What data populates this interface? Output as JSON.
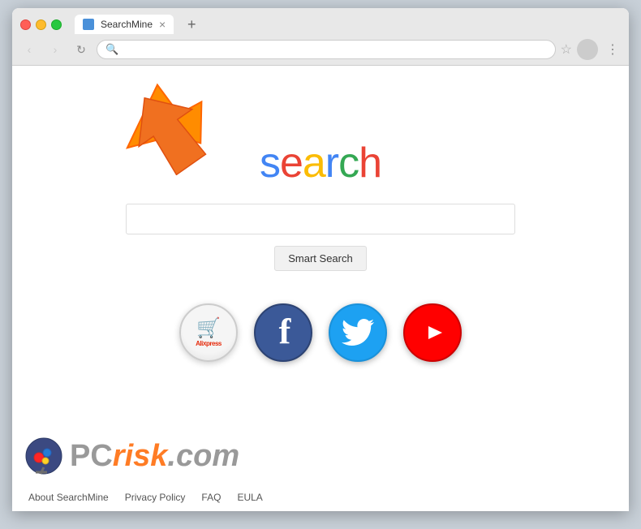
{
  "browser": {
    "tab_label": "SearchMine",
    "tab_close": "×",
    "tab_new": "+",
    "address_value": "",
    "address_placeholder": ""
  },
  "nav": {
    "back": "‹",
    "forward": "›",
    "refresh": "↻"
  },
  "page": {
    "logo_letters": [
      "s",
      "e",
      "a",
      "r",
      "c",
      "h"
    ],
    "search_placeholder": "",
    "smart_search_label": "Smart Search",
    "shortcuts": [
      {
        "id": "aliexpress",
        "label": "AliExpress"
      },
      {
        "id": "facebook",
        "label": "Facebook"
      },
      {
        "id": "twitter",
        "label": "Twitter"
      },
      {
        "id": "youtube",
        "label": "YouTube"
      }
    ]
  },
  "footer": {
    "links": [
      "About SearchMine",
      "Privacy Policy",
      "FAQ",
      "EULA"
    ]
  },
  "watermark": {
    "pc": "PC",
    "risk": "risk",
    "domain": ".com"
  }
}
